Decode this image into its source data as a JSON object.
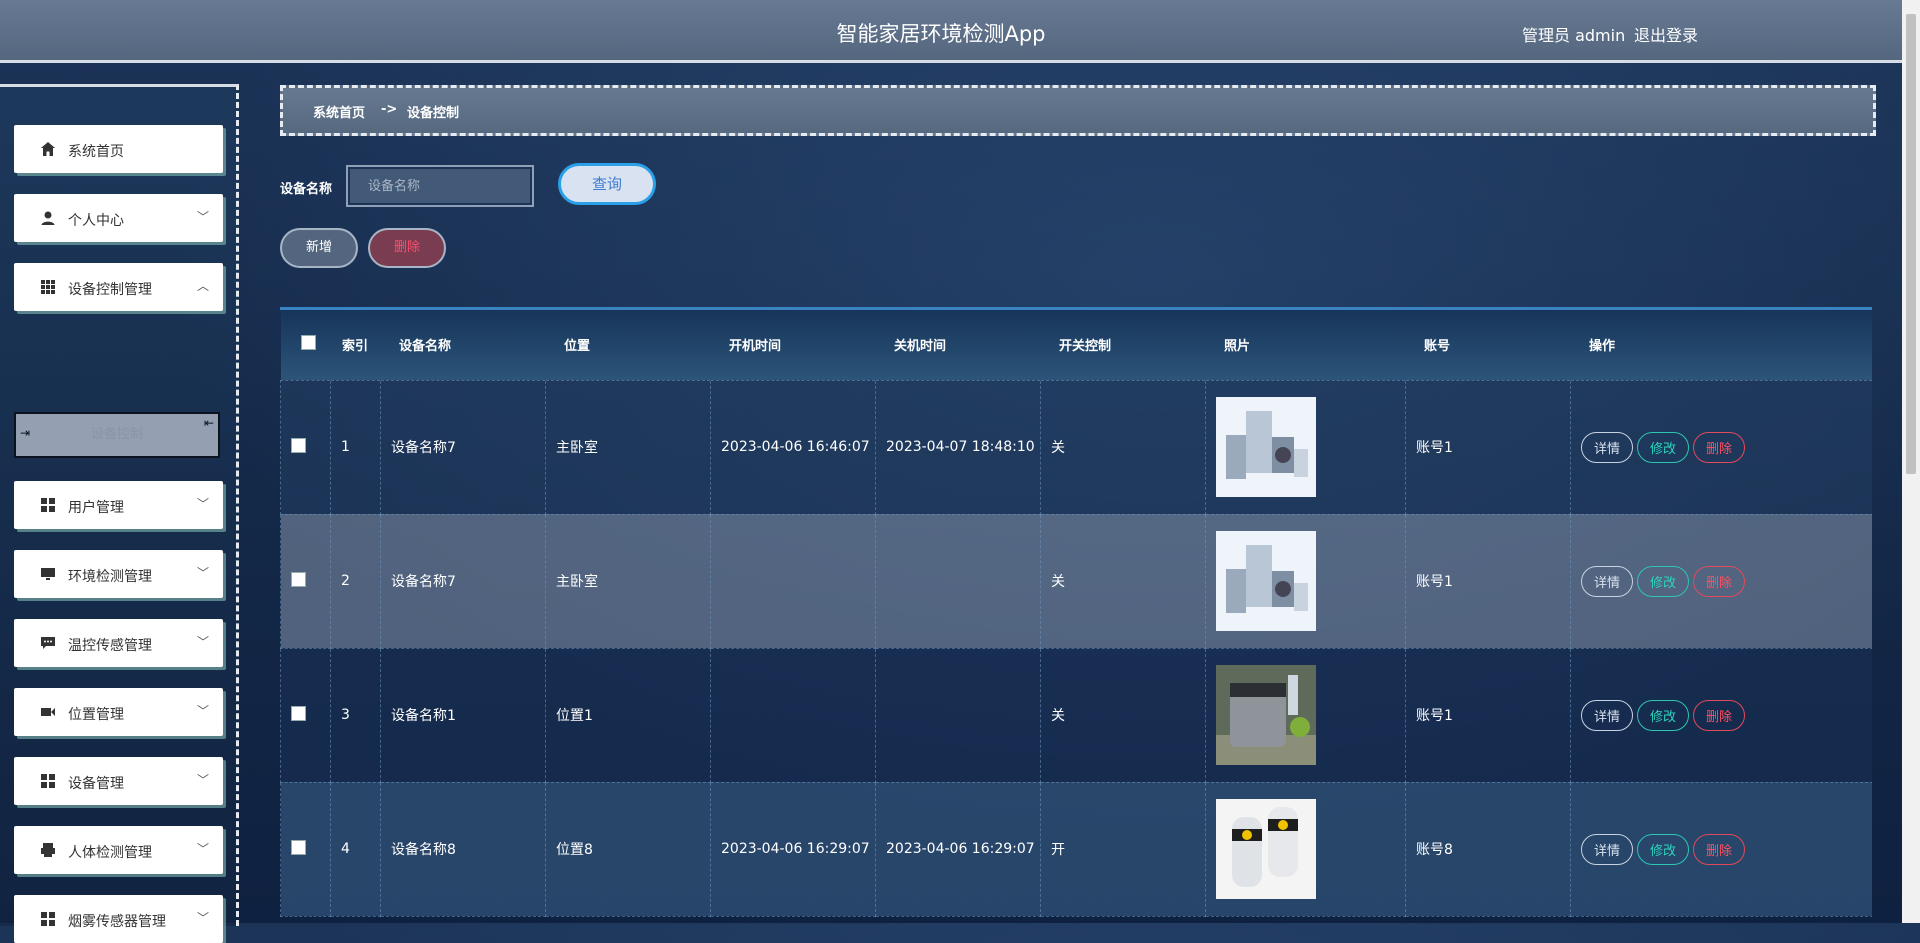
{
  "header": {
    "title": "智能家居环境检测App",
    "user": "管理员 admin",
    "logout": "退出登录"
  },
  "sidebar": {
    "items": [
      {
        "label": "系统首页",
        "icon": "home-icon"
      },
      {
        "label": "个人中心",
        "icon": "user-icon"
      },
      {
        "label": "设备控制管理",
        "icon": "grid-icon"
      },
      {
        "label": "用户管理",
        "icon": "apps-icon"
      },
      {
        "label": "环境检测管理",
        "icon": "monitor-icon"
      },
      {
        "label": "温控传感管理",
        "icon": "chat-icon"
      },
      {
        "label": "位置管理",
        "icon": "camera-icon"
      },
      {
        "label": "设备管理",
        "icon": "apps-icon"
      },
      {
        "label": "人体检测管理",
        "icon": "printer-icon"
      },
      {
        "label": "烟雾传感器管理",
        "icon": "apps-icon"
      }
    ],
    "sub_item": "设备控制"
  },
  "breadcrumb": {
    "home": "系统首页",
    "sep": "->",
    "current": "设备控制"
  },
  "search": {
    "label": "设备名称",
    "placeholder": "设备名称",
    "query": "查询"
  },
  "actions": {
    "add": "新增",
    "delete": "删除"
  },
  "table": {
    "headers": [
      "索引",
      "设备名称",
      "位置",
      "开机时间",
      "关机时间",
      "开关控制",
      "照片",
      "账号",
      "操作"
    ],
    "rows": [
      {
        "idx": "1",
        "name": "设备名称7",
        "loc": "主卧室",
        "on": "2023-04-06 16:46:07",
        "off": "2023-04-07 18:48:10",
        "sw": "关",
        "acct": "账号1"
      },
      {
        "idx": "2",
        "name": "设备名称7",
        "loc": "主卧室",
        "on": "",
        "off": "",
        "sw": "关",
        "acct": "账号1"
      },
      {
        "idx": "3",
        "name": "设备名称1",
        "loc": "位置1",
        "on": "",
        "off": "",
        "sw": "关",
        "acct": "账号1"
      },
      {
        "idx": "4",
        "name": "设备名称8",
        "loc": "位置8",
        "on": "2023-04-06 16:29:07",
        "off": "2023-04-06 16:29:07",
        "sw": "开",
        "acct": "账号8"
      }
    ],
    "ops": {
      "detail": "详情",
      "edit": "修改",
      "delete": "删除"
    }
  }
}
